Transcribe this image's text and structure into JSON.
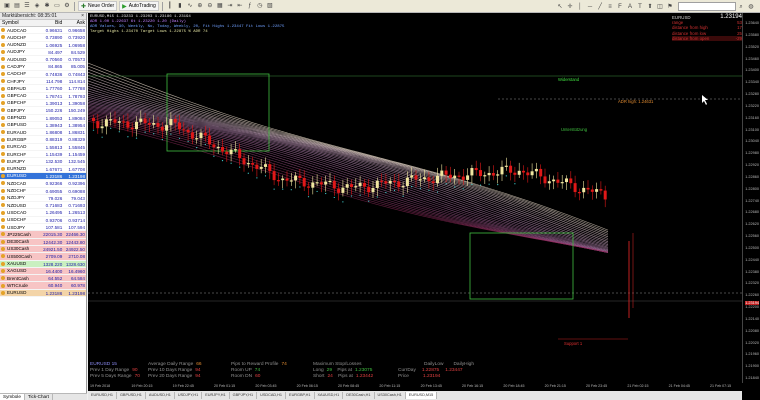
{
  "toolbar": {
    "new_order": "Neue Order",
    "auto_trading": "AutoTrading",
    "search_placeholder": ""
  },
  "market_watch": {
    "title": "Marktübersicht: 08:35:01",
    "columns": [
      "Symbol",
      "Bid",
      "Ask"
    ],
    "rows": [
      {
        "symbol": "AUDCAD",
        "bid": "0.96631",
        "ask": "0.96658",
        "style": ""
      },
      {
        "symbol": "AUDCHF",
        "bid": "0.73890",
        "ask": "0.73920",
        "style": ""
      },
      {
        "symbol": "AUDNZD",
        "bid": "1.06925",
        "ask": "1.06958",
        "style": ""
      },
      {
        "symbol": "AUDJPY",
        "bid": "84.497",
        "ask": "84.529",
        "style": ""
      },
      {
        "symbol": "AUDUSD",
        "bid": "0.70560",
        "ask": "0.70573",
        "style": ""
      },
      {
        "symbol": "CADJPY",
        "bid": "84.865",
        "ask": "85.005",
        "style": ""
      },
      {
        "symbol": "CADCHF",
        "bid": "0.74836",
        "ask": "0.74843",
        "style": ""
      },
      {
        "symbol": "CHFJPY",
        "bid": "114.798",
        "ask": "114.814",
        "style": ""
      },
      {
        "symbol": "GBPAUD",
        "bid": "1.77760",
        "ask": "1.77788",
        "style": ""
      },
      {
        "symbol": "GBPCAD",
        "bid": "1.78741",
        "ask": "1.78793",
        "style": ""
      },
      {
        "symbol": "GBPCHF",
        "bid": "1.39013",
        "ask": "1.39058",
        "style": ""
      },
      {
        "symbol": "GBPJPY",
        "bid": "150.226",
        "ask": "150.249",
        "style": ""
      },
      {
        "symbol": "GBPNZD",
        "bid": "1.89053",
        "ask": "1.89084",
        "style": ""
      },
      {
        "symbol": "GBPUSD",
        "bid": "1.38943",
        "ask": "1.38954",
        "style": ""
      },
      {
        "symbol": "EURAUD",
        "bid": "1.86808",
        "ask": "1.86831",
        "style": ""
      },
      {
        "symbol": "EURGBP",
        "bid": "0.88319",
        "ask": "0.88329",
        "style": ""
      },
      {
        "symbol": "EURCAD",
        "bid": "1.55813",
        "ask": "1.55845",
        "style": ""
      },
      {
        "symbol": "EURCHF",
        "bid": "1.15439",
        "ask": "1.15459",
        "style": ""
      },
      {
        "symbol": "EURJPY",
        "bid": "132.530",
        "ask": "132.545",
        "style": ""
      },
      {
        "symbol": "EURNZD",
        "bid": "1.67671",
        "ask": "1.67708",
        "style": ""
      },
      {
        "symbol": "EURUSD",
        "bid": "1.23186",
        "ask": "1.23198",
        "style": "sel"
      },
      {
        "symbol": "NZDCAD",
        "bid": "0.92366",
        "ask": "0.92396",
        "style": ""
      },
      {
        "symbol": "NZDCHF",
        "bid": "0.69055",
        "ask": "0.69088",
        "style": ""
      },
      {
        "symbol": "NZDJPY",
        "bid": "79.026",
        "ask": "79.043",
        "style": ""
      },
      {
        "symbol": "NZDUSD",
        "bid": "0.71683",
        "ask": "0.71693",
        "style": ""
      },
      {
        "symbol": "USDCAD",
        "bid": "1.26495",
        "ask": "1.26513",
        "style": ""
      },
      {
        "symbol": "USDCHF",
        "bid": "0.93706",
        "ask": "0.93714",
        "style": ""
      },
      {
        "symbol": "USDJPY",
        "bid": "107.581",
        "ask": "107.594",
        "style": ""
      },
      {
        "symbol": "JP225Cash",
        "bid": "22015.30",
        "ask": "22466.30",
        "style": "hl-red"
      },
      {
        "symbol": "DE30Cash",
        "bid": "12442.30",
        "ask": "12443.80",
        "style": "hl-red"
      },
      {
        "symbol": "US30Cash",
        "bid": "24921.50",
        "ask": "24922.50",
        "style": "hl-red"
      },
      {
        "symbol": "US500Cash",
        "bid": "2709.09",
        "ask": "2710.08",
        "style": "hl-red"
      },
      {
        "symbol": "XAUUSD",
        "bid": "1328.220",
        "ask": "1328.630",
        "style": "hl-green"
      },
      {
        "symbol": "XAGUSD",
        "bid": "16.4400",
        "ask": "16.4960",
        "style": "hl-red"
      },
      {
        "symbol": "BrentCash",
        "bid": "64.552",
        "ask": "64.584",
        "style": "hl-red"
      },
      {
        "symbol": "WTICrude",
        "bid": "60.940",
        "ask": "60.978",
        "style": "hl-red"
      },
      {
        "symbol": "EURUSD",
        "bid": "1.23186",
        "ask": "1.23198",
        "style": "hl-orange"
      }
    ],
    "tabs": [
      "Symbole",
      "Tick-Chart"
    ]
  },
  "chart": {
    "symbol_label": "EURUSD,M15",
    "info_lines": [
      "EURUSD,M15  1.23233 1.23203 1.23186 1.23194",
      "ADR 1.00 1.22637  6t 1.23220 1.20 (Daily)",
      "ADR Values, 30, Weekly, No, Today, Weekly, 20, Fit Highs 1.23447  Fit Lows 1.22875",
      "Target Highs 1.23470  Target Lows 1.22875  % ADR 74"
    ],
    "right_panel": {
      "title": "EURUSD",
      "price": "1.23194",
      "rows": [
        {
          "label": "range",
          "value": "53"
        },
        {
          "label": "distance from high",
          "value": "17"
        },
        {
          "label": "distance from low",
          "value": "25"
        },
        {
          "label": "distance from open",
          "value": "-29"
        }
      ]
    },
    "price_labels": [
      "1.23640",
      "1.23580",
      "1.23520",
      "1.23460",
      "1.23400",
      "1.23340",
      "1.23280",
      "1.23220",
      "1.23160",
      "1.23100",
      "1.23040",
      "1.22980",
      "1.22920",
      "1.22860",
      "1.22800",
      "1.22740",
      "1.22680",
      "1.22620",
      "1.22560",
      "1.22500",
      "1.22440",
      "1.22380",
      "1.22320",
      "1.22260",
      "1.22200",
      "1.22140",
      "1.22080",
      "1.22020",
      "1.21960",
      "1.21900",
      "1.21840"
    ],
    "time_labels": [
      "19 Feb 2018",
      "19 Feb 20:15",
      "19 Feb 22:45",
      "20 Feb 01:15",
      "20 Feb 03:45",
      "20 Feb 06:15",
      "20 Feb 08:45",
      "20 Feb 11:15",
      "20 Feb 13:45",
      "20 Feb 16:15",
      "20 Feb 18:45",
      "20 Feb 21:15",
      "20 Feb 23:45",
      "21 Feb 02:15",
      "21 Feb 04:45",
      "21 Feb 07:15"
    ],
    "annotations": {
      "resistance": "Widerstand",
      "adr_high": "ADR high: 1.24631",
      "support_mid": "Unterstützung",
      "support": "Support 1"
    },
    "stats": {
      "symbol": "EURUSD 15",
      "adr_label": "Average Daily Range",
      "adr_value": "66",
      "prev1_label": "Prev 1 Day Range",
      "prev1_value": "90",
      "prev5_label": "Prev 5 Days Range",
      "prev5_value": "70",
      "prev10_label": "Prev 10 Days Range",
      "prev10_value": "94",
      "prev20_label": "Prev 20 Days Range",
      "prev20_value": "94",
      "pr_label": "Pips to Reward Profile",
      "pr_value": "74",
      "room_up_label": "Room UP",
      "room_up_value": "74",
      "room_dn_label": "Room DN",
      "room_dn_value": "60",
      "msl_label": "Maximum Stop/Losses",
      "long_label": "Long",
      "long_value": "29",
      "long_pips": "Pips at",
      "long_price": "1.23075",
      "short_label": "Short",
      "short_value": "24",
      "short_pips": "Pips at",
      "short_price": "1.23442",
      "daily_low_label": "DailyLow",
      "daily_high_label": "DailyHigh",
      "cur_day_label": "CurrDay",
      "cur_day_low": "1.22875",
      "cur_day_high": "1.23447",
      "price_label": "Price",
      "price_value": "1.23194"
    },
    "tabs": [
      "EURUSD,H1",
      "GBPUSD,H1",
      "AUDUSD,H1",
      "USDJPY,H1",
      "EURJPY,H1",
      "GBPJPY,H1",
      "USDCAD,H1",
      "EURGBP,H1",
      "XAUUSD,H1",
      "DE30Cash,H1",
      "US30Cash,H1",
      "EURUSD,M15"
    ]
  }
}
